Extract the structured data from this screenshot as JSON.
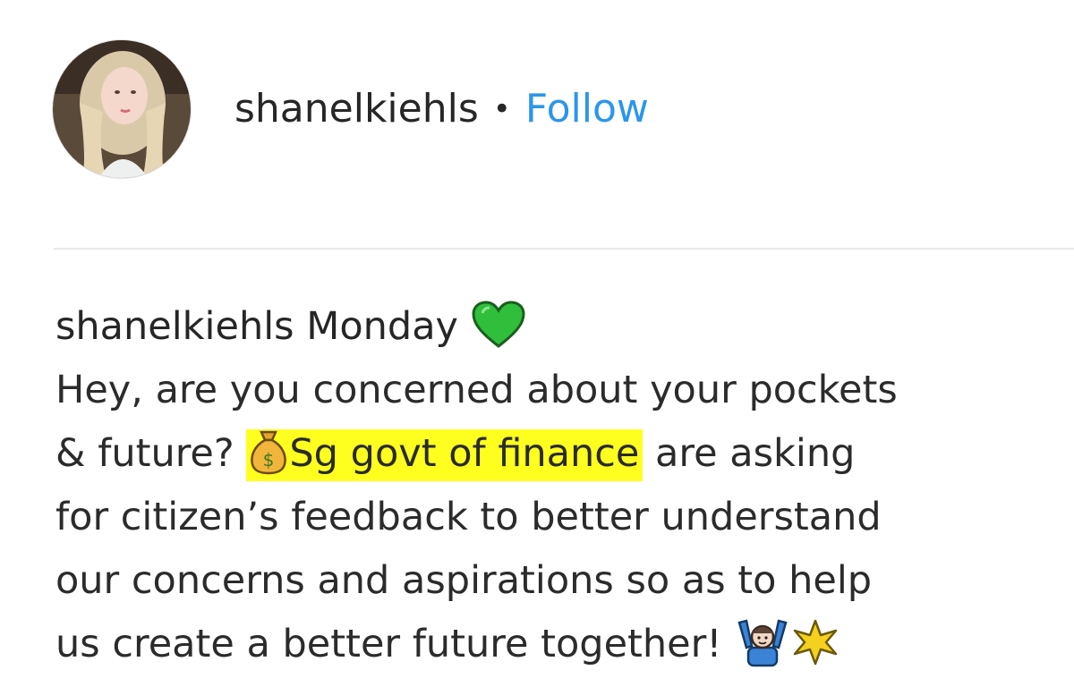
{
  "header": {
    "username": "shanelkiehls",
    "separator": "•",
    "follow_label": "Follow"
  },
  "caption": {
    "username": "shanelkiehls",
    "day": "Monday",
    "emojis": [
      "green-heart-icon",
      "money-bag-icon",
      "person-raising-hands-icon",
      "sparkle-icon"
    ],
    "line1_text": "Hey, are you concerned about your pockets",
    "line2_pre": "& future? ",
    "line2_highlight": "Sg govt of finance",
    "line2_post": " are asking",
    "line3_text": "for citizen’s feedback to better understand",
    "line4_text": "our concerns and aspirations so as to help",
    "line5_text": "us create a better future together! "
  },
  "colors": {
    "follow": "#2b96ec",
    "highlight": "#ffff1f",
    "text": "#262626",
    "divider": "#e8e8e8"
  }
}
